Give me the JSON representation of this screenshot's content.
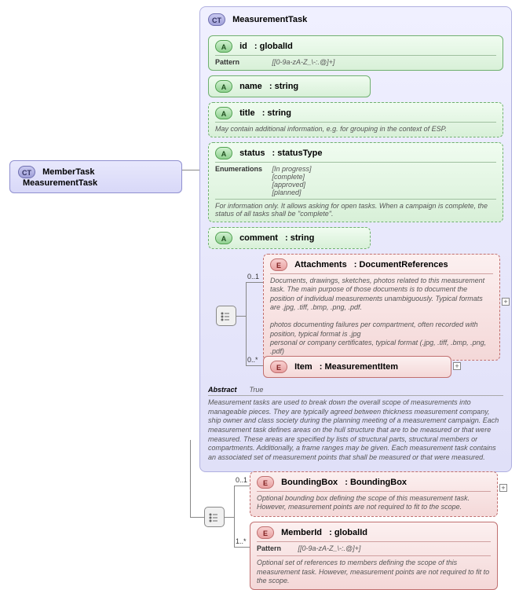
{
  "root": {
    "badge": "CT",
    "name": "MemberTask",
    "type": "MeasurementTask"
  },
  "mainCT": {
    "badge": "CT",
    "name": "MeasurementTask"
  },
  "attrs": {
    "id": {
      "badge": "A",
      "name": "id",
      "type": ": globalId",
      "patternLabel": "Pattern",
      "pattern": "[[0-9a-zA-Z_\\-:.@]+]"
    },
    "name": {
      "badge": "A",
      "name": "name",
      "type": ": string"
    },
    "title": {
      "badge": "A",
      "name": "title",
      "type": ": string",
      "desc": "May contain additional information, e.g. for grouping in the context of ESP."
    },
    "status": {
      "badge": "A",
      "name": "status",
      "type": ": statusType",
      "enumLabel": "Enumerations",
      "e1": "[In progress]",
      "e2": "[complete]",
      "e3": "[approved]",
      "e4": "[planned]",
      "desc": "For information only. It allows asking for open tasks. When a campaign is complete, the status of all tasks shall be \"complete\"."
    },
    "comment": {
      "badge": "A",
      "name": "comment",
      "type": ": string"
    }
  },
  "elements": {
    "attachments": {
      "badge": "E",
      "name": "Attachments",
      "type": ": DocumentReferences",
      "mult": "0..1",
      "desc": "Documents, drawings, sketches, photos related to this measurement task. The main purpose of those documents is to document the position of individual measurements unambiguously. Typical formats are .jpg, .tiff, .bmp, .png, .pdf.\n\n  photos documenting failures per compartment, often recorded with position, typical format is .jpg\n  personal or company certificates, typical format (.jpg, .tiff, .bmp, .png, .pdf)"
    },
    "item": {
      "badge": "E",
      "name": "Item",
      "type": ": MeasurementItem",
      "mult": "0..*"
    },
    "boundingBox": {
      "badge": "E",
      "name": "BoundingBox",
      "type": ": BoundingBox",
      "mult": "0..1",
      "desc": "Optional bounding box defining the scope of this measurement task. However, measurement points are not required to fit to the scope."
    },
    "memberId": {
      "badge": "E",
      "name": "MemberId",
      "type": ": globalId",
      "mult": "1..*",
      "patternLabel": "Pattern",
      "pattern": "[[0-9a-zA-Z_\\-:.@]+]",
      "desc": "Optional set of references to members defining the scope of this measurement task. However, measurement points are not required to fit to the scope."
    }
  },
  "abstract": {
    "label": "Abstract",
    "value": "True",
    "desc": "Measurement tasks are used to break down the overall scope of measurements into manageable pieces. They are typically agreed between thickness measurement company, ship owner and class society during the planning meeting of a measurement campaign. Each measurement task defines areas on the hull structure that are to be measured or that were measured. These areas are specified by lists of structural parts, structural members or compartments. Additionally, a frame ranges may be given. Each measurement task contains an associated set of measurement points that shall be measured or that were measured."
  }
}
